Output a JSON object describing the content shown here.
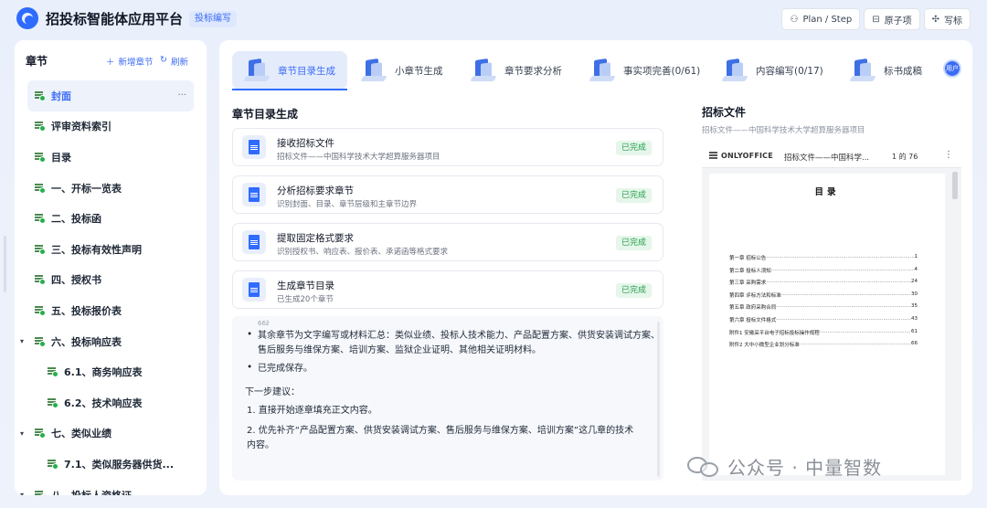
{
  "header": {
    "app_title": "招投标智能体应用平台",
    "badge": "投标编写",
    "buttons": [
      {
        "label": "Plan / Step",
        "icon": "plan-icon"
      },
      {
        "label": "原子项",
        "icon": "atom-item-icon"
      },
      {
        "label": "写标",
        "icon": "write-bid-icon"
      }
    ]
  },
  "sidebar": {
    "title": "章节",
    "add_label": "新增章节",
    "refresh_label": "刷新",
    "items": [
      {
        "label": "封面",
        "active": true,
        "level": 0
      },
      {
        "label": "评审资料索引",
        "level": 0
      },
      {
        "label": "目录",
        "level": 0
      },
      {
        "label": "一、开标一览表",
        "level": 0
      },
      {
        "label": "二、投标函",
        "level": 0
      },
      {
        "label": "三、投标有效性声明",
        "level": 0
      },
      {
        "label": "四、授权书",
        "level": 0
      },
      {
        "label": "五、投标报价表",
        "level": 0
      },
      {
        "label": "六、投标响应表",
        "level": 0,
        "expanded": true
      },
      {
        "label": "6.1、商务响应表",
        "level": 1
      },
      {
        "label": "6.2、技术响应表",
        "level": 1
      },
      {
        "label": "七、类似业绩",
        "level": 0,
        "expanded": true
      },
      {
        "label": "7.1、类似服务器供货...",
        "level": 1
      },
      {
        "label": "八、投标人资格证...",
        "level": 0,
        "expanded": true
      }
    ]
  },
  "tabs": [
    {
      "label": "章节目录生成",
      "active": true
    },
    {
      "label": "小章节生成"
    },
    {
      "label": "章节要求分析"
    },
    {
      "label": "事实项完善(0/61)"
    },
    {
      "label": "内容编写(0/17)"
    },
    {
      "label": "标书成稿"
    }
  ],
  "avatar_text": "用户",
  "main": {
    "section_title": "章节目录生成",
    "steps": [
      {
        "title": "接收招标文件",
        "desc": "招标文件——中国科学技术大学超算服务器项目",
        "status": "已完成"
      },
      {
        "title": "分析招标要求章节",
        "desc": "识别封面、目录、章节层级和主章节边界",
        "status": "已完成"
      },
      {
        "title": "提取固定格式要求",
        "desc": "识别授权书、响应表、报价表、承诺函等格式要求",
        "status": "已完成"
      },
      {
        "title": "生成章节目录",
        "desc": "已生成20个章节",
        "status": "已完成"
      }
    ],
    "chat": {
      "cut_text": "66ž",
      "bullet1": "其余章节为文字编写或材料汇总：类似业绩、投标人技术能力、产品配置方案、供货安装调试方案、售后服务与维保方案、培训方案、监狱企业证明、其他相关证明材料。",
      "bullet2": "已完成保存。",
      "next_title": "下一步建议：",
      "next1": "1. 直接开始逐章填充正文内容。",
      "next2": "2. 优先补齐“产品配置方案、供货安装调试方案、售后服务与维保方案、培训方案”这几章的技术内容。"
    }
  },
  "doc": {
    "title": "招标文件",
    "subtitle": "招标文件——中国科学技术大学超算服务器项目",
    "viewer_brand": "ONLYOFFICE",
    "viewer_name": "招标文件——中国科学...",
    "page_indicator": "1 的 76",
    "toc_title": "目录",
    "toc": [
      {
        "label": "第一章 招标公告",
        "page": "1"
      },
      {
        "label": "第二章 投标人须知",
        "page": "4"
      },
      {
        "label": "第三章 采购需求",
        "page": "24"
      },
      {
        "label": "第四章 评标方法和标准",
        "page": "30"
      },
      {
        "label": "第五章 政府采购合同",
        "page": "35"
      },
      {
        "label": "第六章 投标文件格式",
        "page": "43"
      },
      {
        "label": "附件1 安徽采平台电子招标投标操作规程",
        "page": "61"
      },
      {
        "label": "附件2 大中小微型企业划分标准",
        "page": "66"
      }
    ]
  },
  "watermark": "公众号 · 中量智数",
  "colors": {
    "accent": "#2f6bff",
    "success": "#22a04a"
  }
}
